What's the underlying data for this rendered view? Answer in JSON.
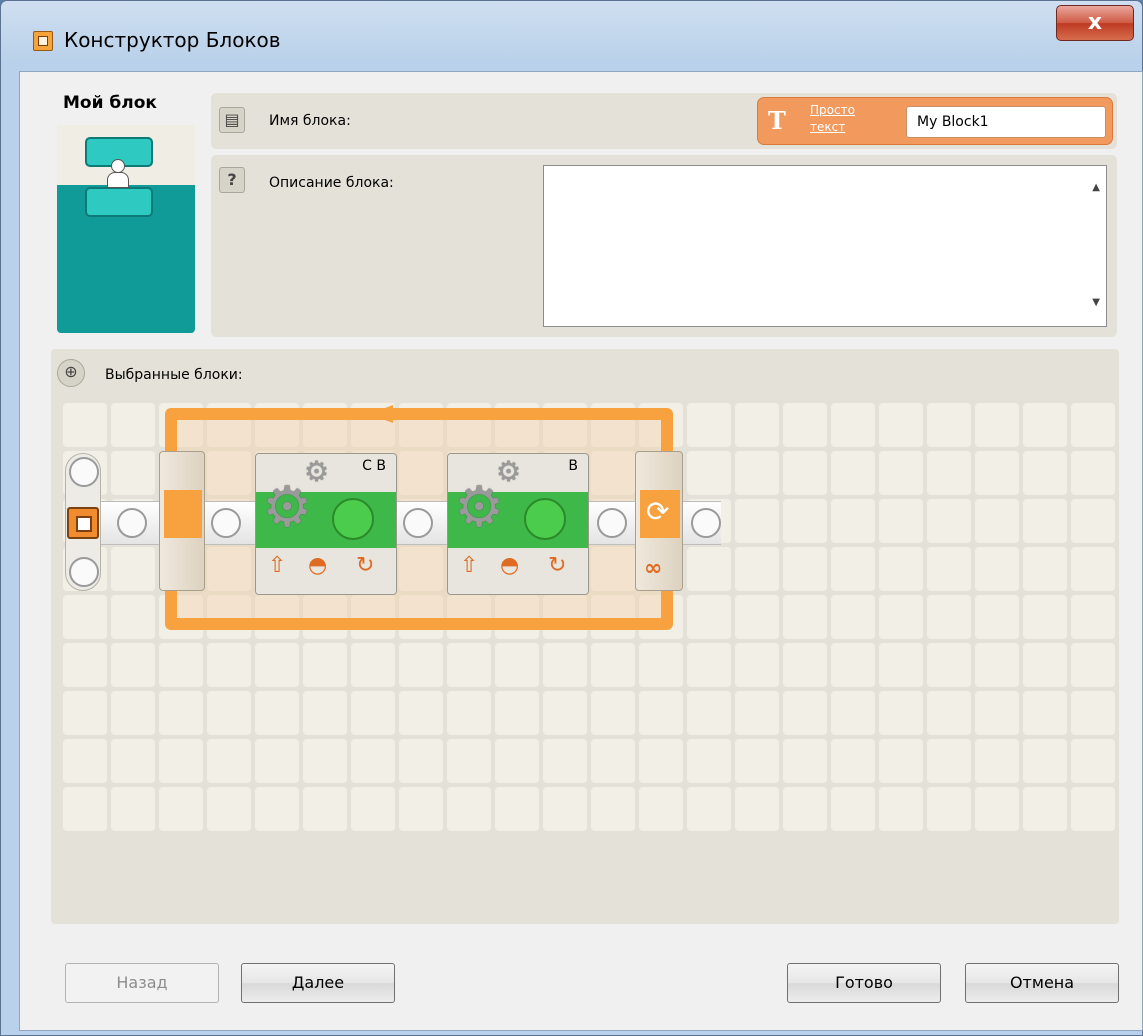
{
  "window": {
    "title": "Конструктор Блоков",
    "close_label": "x"
  },
  "preview": {
    "label": "Мой блок"
  },
  "name_row": {
    "label": "Имя блока:",
    "text_type_link": "Просто текст",
    "value": "My Block1"
  },
  "desc_row": {
    "label": "Описание блока:",
    "value": ""
  },
  "selected": {
    "label": "Выбранные блоки:",
    "blocks": [
      {
        "type": "motor",
        "ports": "C B"
      },
      {
        "type": "motor",
        "ports": "B"
      }
    ],
    "loop_symbol": "∞"
  },
  "buttons": {
    "back": "Назад",
    "next": "Далее",
    "done": "Готово",
    "cancel": "Отмена"
  },
  "colors": {
    "accent_orange": "#f7a23e",
    "block_teal": "#109a98",
    "motor_green": "#3fb84a"
  }
}
